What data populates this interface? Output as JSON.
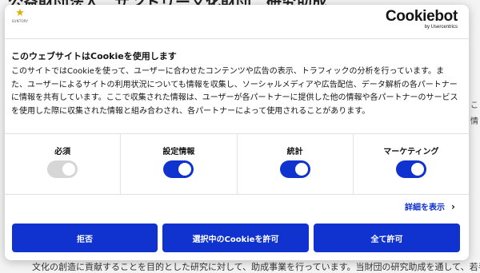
{
  "background": {
    "title": "公益財団法人　サントリー文化財団　研究助成",
    "body": "文化の創造に貢献することを目的とした研究に対して、助成事業を行っています。当財団の研究助成を通して、若手研究",
    "side_chars": [
      "こ",
      "情"
    ]
  },
  "header": {
    "logo_text": "SUNTORY",
    "brand_name": "Cookiebot",
    "brand_sub": "by Usercentrics"
  },
  "consent": {
    "title": "このウェブサイトはCookieを使用します",
    "text": "このサイトではCookieを使って、ユーザーに合わせたコンテンツや広告の表示、トラフィックの分析を行っています。また、ユーザーによるサイトの利用状況についても情報を収集し、ソーシャルメディアや広告配信、データ解析の各パートナーに情報を共有しています。ここで収集された情報は、ユーザーが各パートナーに提供した他の情報や各パートナーのサービスを使用した際に収集された情報と組み合わされ、各パートナーによって使用されることがあります。"
  },
  "toggles": [
    {
      "label": "必須",
      "state": "on-disabled"
    },
    {
      "label": "設定情報",
      "state": "on"
    },
    {
      "label": "統計",
      "state": "on"
    },
    {
      "label": "マーケティング",
      "state": "on"
    }
  ],
  "details_link": "詳細を表示",
  "buttons": {
    "deny": "拒否",
    "allow_selection": "選択中のCookieを許可",
    "allow_all": "全て許可"
  },
  "colors": {
    "accent": "#1032cf",
    "disabled_toggle": "#d6d6d6"
  }
}
